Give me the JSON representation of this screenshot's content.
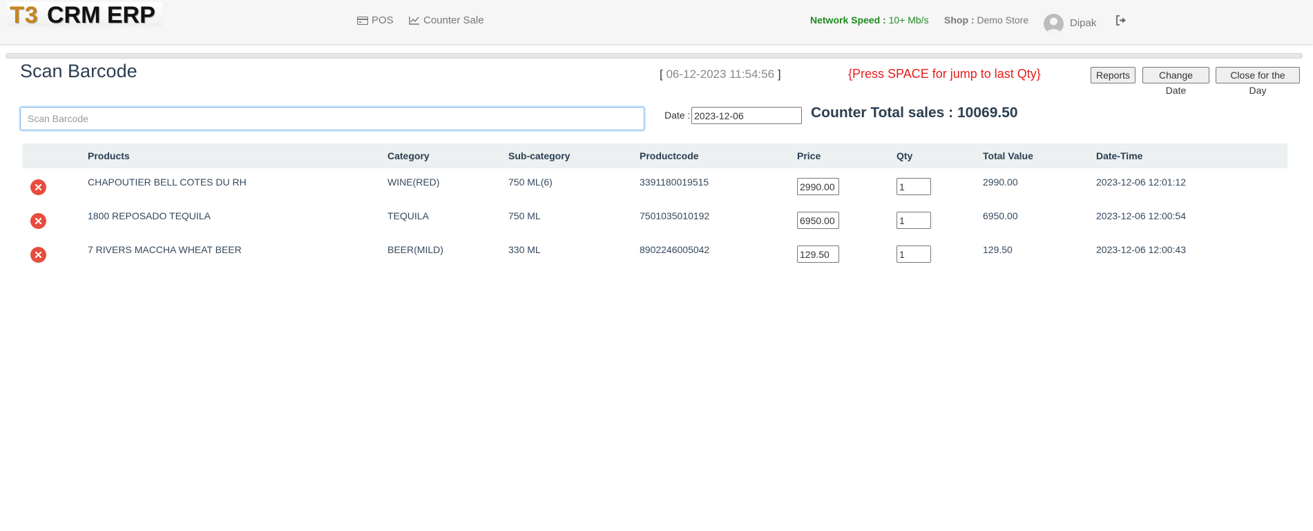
{
  "brand": {
    "logo_t3": "T3",
    "logo_rest": "CRM ERP"
  },
  "nav": {
    "pos_label": "POS",
    "counter_sale_label": "Counter Sale"
  },
  "status": {
    "network_label": "Network Speed :",
    "network_value": "10+ Mb/s",
    "shop_label": "Shop :",
    "shop_value": "Demo Store",
    "user_name": "Dipak"
  },
  "page": {
    "title": "Scan Barcode",
    "clock_open": "[",
    "clock_value": "06-12-2023 11:54:56",
    "clock_close": "]",
    "hint": "{Press SPACE for jump to last Qty}"
  },
  "buttons": {
    "reports": "Reports",
    "change_date": "Change Date",
    "close_day": "Close for the Day"
  },
  "scan": {
    "placeholder": "Scan Barcode",
    "value": ""
  },
  "date_field": {
    "label": "Date :",
    "value": "2023-12-06"
  },
  "counter_total": "Counter Total sales : 10069.50",
  "table": {
    "headers": {
      "products": "Products",
      "category": "Category",
      "subcategory": "Sub-category",
      "productcode": "Productcode",
      "price": "Price",
      "qty": "Qty",
      "total": "Total Value",
      "datetime": "Date-Time"
    },
    "rows": [
      {
        "product": "CHAPOUTIER BELL COTES DU RH",
        "category": "WINE(RED)",
        "subcategory": "750 ML(6)",
        "code": "3391180019515",
        "price": "2990.00",
        "qty": "1",
        "total": "2990.00",
        "datetime": "2023-12-06 12:01:12"
      },
      {
        "product": "1800 REPOSADO TEQUILA",
        "category": "TEQUILA",
        "subcategory": "750 ML",
        "code": "7501035010192",
        "price": "6950.00",
        "qty": "1",
        "total": "6950.00",
        "datetime": "2023-12-06 12:00:54"
      },
      {
        "product": "7 RIVERS MACCHA WHEAT BEER",
        "category": "BEER(MILD)",
        "subcategory": "330 ML",
        "code": "8902246005042",
        "price": "129.50",
        "qty": "1",
        "total": "129.50",
        "datetime": "2023-12-06 12:00:43"
      }
    ]
  },
  "colors": {
    "accent_green": "#1e8a1e",
    "hint_red": "#e81b1b",
    "delete_red": "#e74c3c",
    "heading": "#2c3e50"
  },
  "icons": {
    "pos": "credit-card-icon",
    "counter_sale": "line-chart-icon",
    "logout": "sign-out-icon",
    "delete": "times-circle-icon",
    "avatar": "user-avatar-icon"
  }
}
